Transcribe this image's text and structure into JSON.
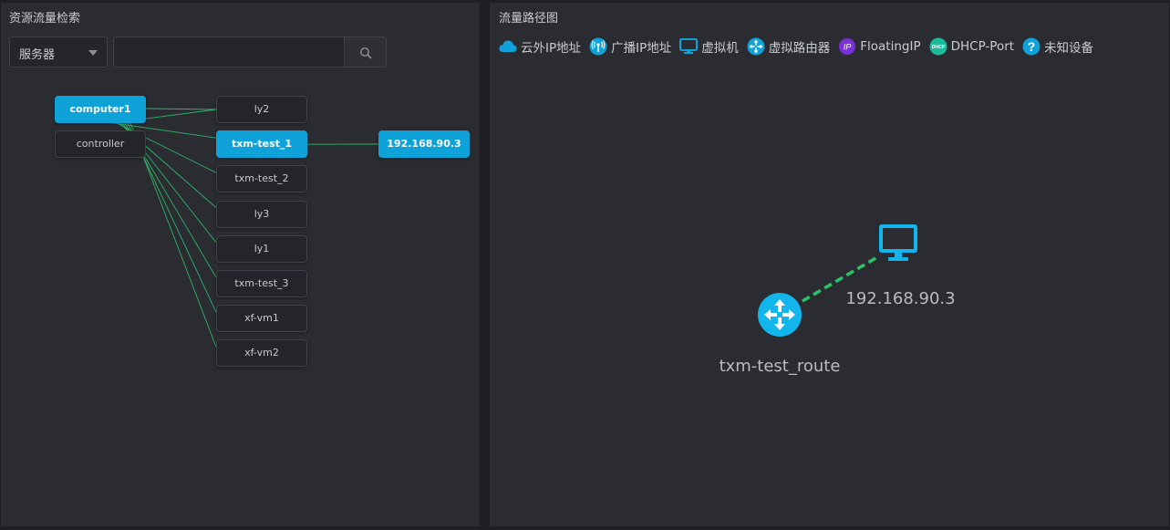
{
  "left_panel": {
    "title": "资源流量检索",
    "select": {
      "value": "服务器"
    },
    "search": {
      "placeholder": "",
      "value": ""
    }
  },
  "graph": {
    "hosts": [
      {
        "label": "computer1",
        "active": true
      },
      {
        "label": "controller",
        "active": false
      }
    ],
    "vms": [
      {
        "label": "ly2",
        "active": false
      },
      {
        "label": "txm-test_1",
        "active": true
      },
      {
        "label": "txm-test_2",
        "active": false
      },
      {
        "label": "ly3",
        "active": false
      },
      {
        "label": "ly1",
        "active": false
      },
      {
        "label": "txm-test_3",
        "active": false
      },
      {
        "label": "xf-vm1",
        "active": false
      },
      {
        "label": "xf-vm2",
        "active": false
      }
    ],
    "ip": {
      "label": "192.168.90.3",
      "active": true
    },
    "line_color": "#2ecc71"
  },
  "right_panel": {
    "title": "流量路径图",
    "legend": [
      {
        "icon": "cloud-icon",
        "label": "云外IP地址",
        "color": "#0ea2d9"
      },
      {
        "icon": "broadcast-icon",
        "label": "广播IP地址",
        "color": "#0ea2d9"
      },
      {
        "icon": "monitor-icon",
        "label": "虚拟机",
        "color": "#0ea2d9"
      },
      {
        "icon": "router-icon",
        "label": "虚拟路由器",
        "color": "#0ea2d9"
      },
      {
        "icon": "ip-icon",
        "label": "FloatingIP",
        "color": "#7b2fd6"
      },
      {
        "icon": "dhcp-icon",
        "label": "DHCP-Port",
        "color": "#1abc9c"
      },
      {
        "icon": "question-icon",
        "label": "未知设备",
        "color": "#0ea2d9"
      }
    ],
    "topology": {
      "router_label": "txm-test_route",
      "vm_label": "192.168.90.3",
      "link_color": "#27c46a"
    }
  },
  "colors": {
    "accent": "#0ea2d9",
    "panel_bg": "#2a2c31",
    "page_bg": "#1d1f23"
  }
}
